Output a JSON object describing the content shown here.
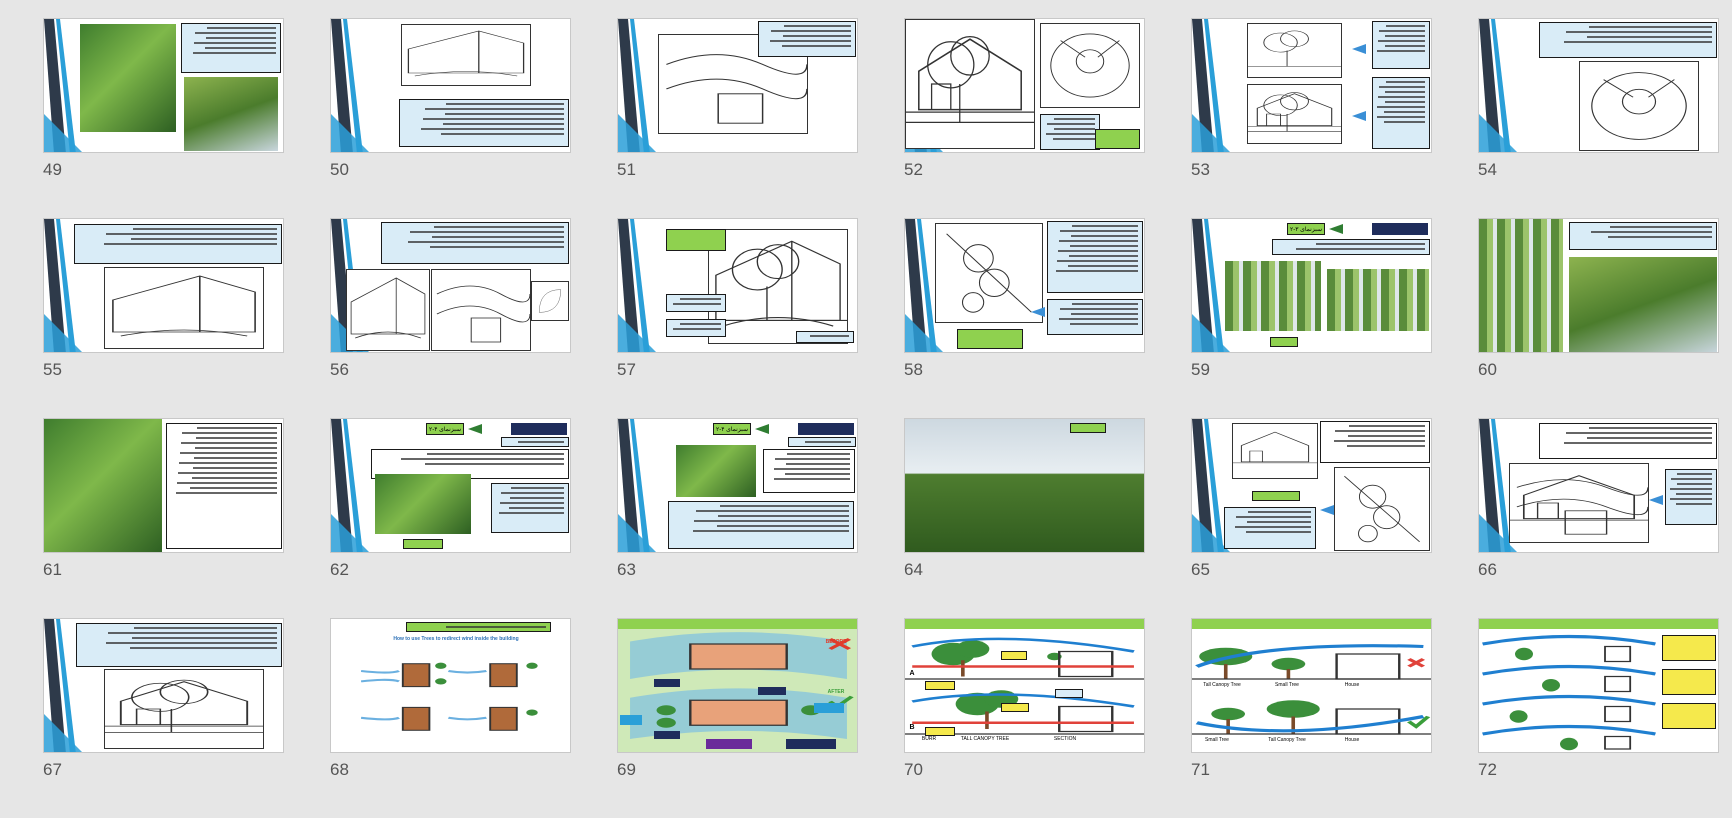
{
  "slides": [
    {
      "num": "49",
      "layout": "photo-text"
    },
    {
      "num": "50",
      "layout": "sketch-text"
    },
    {
      "num": "51",
      "layout": "sketch-text"
    },
    {
      "num": "52",
      "layout": "diagram"
    },
    {
      "num": "53",
      "layout": "two-sketch"
    },
    {
      "num": "54",
      "layout": "sketch-text"
    },
    {
      "num": "55",
      "layout": "sketch-text"
    },
    {
      "num": "56",
      "layout": "multi-sketch"
    },
    {
      "num": "57",
      "layout": "sketch-labels"
    },
    {
      "num": "58",
      "layout": "sketch-text"
    },
    {
      "num": "59",
      "layout": "title-photos"
    },
    {
      "num": "60",
      "layout": "photos-text"
    },
    {
      "num": "61",
      "layout": "photo-text"
    },
    {
      "num": "62",
      "layout": "title-photo"
    },
    {
      "num": "63",
      "layout": "title-photo"
    },
    {
      "num": "64",
      "layout": "full-photo"
    },
    {
      "num": "65",
      "layout": "sketch-text"
    },
    {
      "num": "66",
      "layout": "sketch-text"
    },
    {
      "num": "67",
      "layout": "sketch-text"
    },
    {
      "num": "68",
      "layout": "diagram"
    },
    {
      "num": "69",
      "layout": "diagram"
    },
    {
      "num": "70",
      "layout": "diagram"
    },
    {
      "num": "71",
      "layout": "diagram"
    },
    {
      "num": "72",
      "layout": "diagram"
    }
  ],
  "diagram_text": {
    "slide68": "How to use Trees to redirect wind inside the building",
    "slide69_badge": "BEFORE",
    "slide69_after": "AFTER",
    "slide70_a": "A",
    "slide70_b": "B",
    "slide70_burr": "BURR",
    "slide70_tall": "TALL CANOPY TREE",
    "slide70_section": "SECTION",
    "slide71_top_left": "Tall Canopy Tree",
    "slide71_top_mid": "Small Tree",
    "slide71_top_right": "House",
    "slide71_bot_left": "Small Tree",
    "slide71_bot_mid": "Tall Canopy Tree",
    "slide71_bot_right": "House",
    "slide59_title": "۲-۳ سبزنمای",
    "slide62_title": "۲-۴ سبزنمای",
    "slide63_title": "۲-۴ سبزنمای"
  },
  "colors": {
    "background": "#e6e6e6",
    "accent_dark": "#2e3a4a",
    "accent_blue": "#2a9fd8",
    "textbox_fill": "#d9ecf7",
    "label_green": "#8fd14f"
  }
}
